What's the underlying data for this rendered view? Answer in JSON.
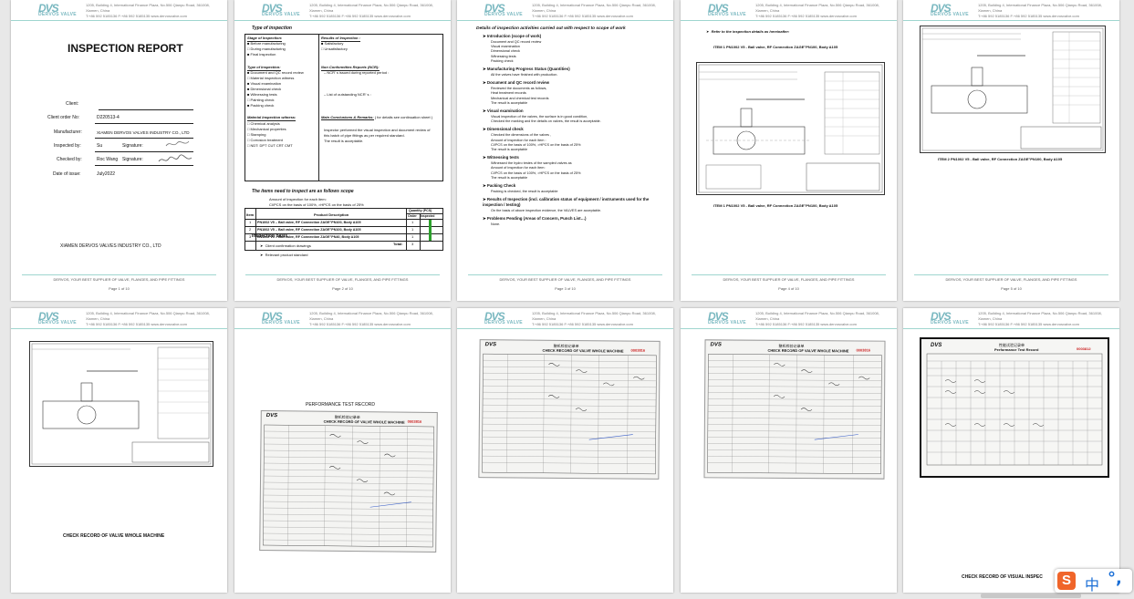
{
  "header": {
    "logo": "DVS",
    "logo_sub": "DERVOS VALVE",
    "address": "1205, Building 4, International Finance Plaza, No.506 Qianpu Road, 361008, Xiamen, China",
    "contact": "T:+86 592 5185136   F:+86 592 5185135   www.dervosvalve.com"
  },
  "footer": {
    "slogan": "DERVOS, YOUR BEST SUPPLIER OF VALVE, FLANGES, AND PIPE FITTINGS"
  },
  "page1": {
    "title": "INSPECTION REPORT",
    "fields": [
      {
        "label": "Client:",
        "value": ""
      },
      {
        "label": "Client order No:",
        "value": "D220513-4"
      },
      {
        "label": "Manufacturer:",
        "value": "XIAMEN DERVOS VALVES INDUSTRY CO., LTD"
      },
      {
        "label": "Inspected by:",
        "value": "Su",
        "label2": "Signature:"
      },
      {
        "label": "Checked by:",
        "value": "Roc Wang",
        "label2": "Signature:"
      },
      {
        "label": "Date of issue:",
        "value": "July2022"
      }
    ],
    "company": "XIAMEN DERVOS VALVES INDUSTRY CO., LTD",
    "page_no": "Page 1 of 10"
  },
  "page2": {
    "type_title": "Type of inspection",
    "stage_title": "Stage of Inspection:",
    "stage_items": [
      "Before manufacturing",
      "During manufacturing",
      "Final inspection"
    ],
    "results_title": "Results of Inspection :",
    "results_items": [
      "Satisfactory",
      "Unsatisfactory"
    ],
    "type2_title": "Type of Inspection:",
    "type2_items": [
      "Document and QC record review",
      "Material inspection witness",
      "Visual examination",
      "Dimensional check",
      "Witnessing tests",
      "Painting check",
      "Packing check"
    ],
    "ncr_title": "Non Conformities Reports (NCR):",
    "ncr_line1": "NCR' s issued during reported period :",
    "ncr_line2": "List of outstanding NCR' s :",
    "material_title": "Material Inspection witness:",
    "material_items": [
      "Chemical analysis",
      "Mechanical properties",
      "Stamping",
      "Corrosion treatment",
      "NDT: DPT  CUT  CRT  CMT"
    ],
    "conclusion_title": "Main Conclusions & Remarks:",
    "conclusion_note": "( for details see continuation sheet )",
    "conclusion_text": [
      "Inspector performed the visual inspection and document review of",
      "this batch of pipe fittings as per required standard.",
      "The result is acceptable."
    ],
    "scope_title": "The items need to inspect are as follows scope",
    "scope_line1": "Amount of inspection for each item:",
    "scope_line2": "CI/PCS on the basis of 100%,    >HPCS on the basis of 25%",
    "table_headers": [
      "Item",
      "Product Description",
      "Quantity (PCS)",
      "Order",
      "Inspected"
    ],
    "rows": [
      {
        "item": "1",
        "desc": "PN1002 V5  –  Ball valve, RF Connection ZAGE\"PN100, Body A105",
        "order": "1"
      },
      {
        "item": "2",
        "desc": "PN1002 V5  –  Ball valve, RF Connection ZAGE\"PN100, Body A105",
        "order": "1"
      },
      {
        "item": "3",
        "desc": "PN1002 V5  –  Ball valve, RF Connection ZAGE\"PN40, Body A105",
        "order": "1"
      }
    ],
    "total_label": "Total:",
    "total_value": "3",
    "inspected_fraction": 1,
    "basis_title": "Inspection basis",
    "basis_items": [
      "Client confirmation drawings",
      "Relevant product standard"
    ],
    "page_no": "Page 2 of 10"
  },
  "page3": {
    "title": "Details of inspection activities carried out with respect to scope of work",
    "sections": [
      {
        "h": "Introduction (scope of work)",
        "lines": [
          "Document and QC record review",
          "Visual examination",
          "Dimensional check",
          "Witnessing tests",
          "Packing check"
        ]
      },
      {
        "h": "Manufacturing Progress Status (Quantities)",
        "lines": [
          "All the valves have finished with production."
        ]
      },
      {
        "h": "Document and QC record review",
        "lines": [
          "Reviewed the documents as follows,",
          "Heat treatment records",
          "Mechanical and chemical test records",
          "The result is acceptable"
        ]
      },
      {
        "h": "Visual examination",
        "lines": [
          "Visual inspection of the valves, the surface is in good condition,",
          "Checked the marking and the details on valves, the result is acceptable."
        ]
      },
      {
        "h": "Dimensional check",
        "lines": [
          "Checked the dimensions of the valves ,",
          "Amount of inspection for each item :",
          "CI/PCS on the basis of 100%,    >HPCS on the basis of 25%",
          "The result is acceptable"
        ]
      },
      {
        "h": "Witnessing tests",
        "lines": [
          "Witnessed the hydro testes of the sampled valves as",
          "Amount of inspection for each item:",
          "CI/PCS on the basis of 100%,    >HPCS on the basis of 25%",
          "The result is acceptable"
        ]
      },
      {
        "h": "Packing Check",
        "lines": [
          "Packing is checked, the result is acceptable"
        ]
      },
      {
        "h": "Results of Inspection (incl. calibration status of equipment / instruments used for the inspection / testing)",
        "lines": [
          "On the basis of above inspection evidence, the VALVES are acceptable."
        ]
      },
      {
        "h": "Problems Pending (Areas of Concern, Punch List…)",
        "lines": [
          "None."
        ]
      }
    ],
    "page_no": "Page 3 of 10"
  },
  "page4": {
    "intro": "Refer to the inspection details as hereinafter:",
    "item_line": "ITEM 1 PN1002 V5  -  Ball valve, RF Connection ZAGE\"PN100, Body A105",
    "caption": "ITEM 1 PN1002 V5  -  Ball valve, RF Connection ZAGE\"PN100, Body A105",
    "page_no": "Page 4 of 10"
  },
  "page5": {
    "caption": "ITEM 2 PN1002 V5  -  Ball valve, RF Connection ZAGE\"PN100, Body A105",
    "page_no": "Page 5 of 10"
  },
  "page7": {
    "title": "PERFORMANCE TEST RECORD"
  },
  "page6": {
    "bottom_title": "CHECK RECORD OF VALVE WHOLE MACHINE"
  },
  "page10": {
    "bottom_title": "CHECK RECORD OF VISUAL INSPEC"
  },
  "form": {
    "title_cn": "整机检验记录单",
    "title_en": "CHECK RECORD OF VALVE WHOLE MACHINE",
    "serial": "0003816"
  },
  "form_perf": {
    "title_cn": "性能试验记录单",
    "title_en": "Performance Test Record",
    "serial": "0003812"
  },
  "ime": {
    "logo": "S",
    "lang": "中",
    "punct": "°,"
  }
}
